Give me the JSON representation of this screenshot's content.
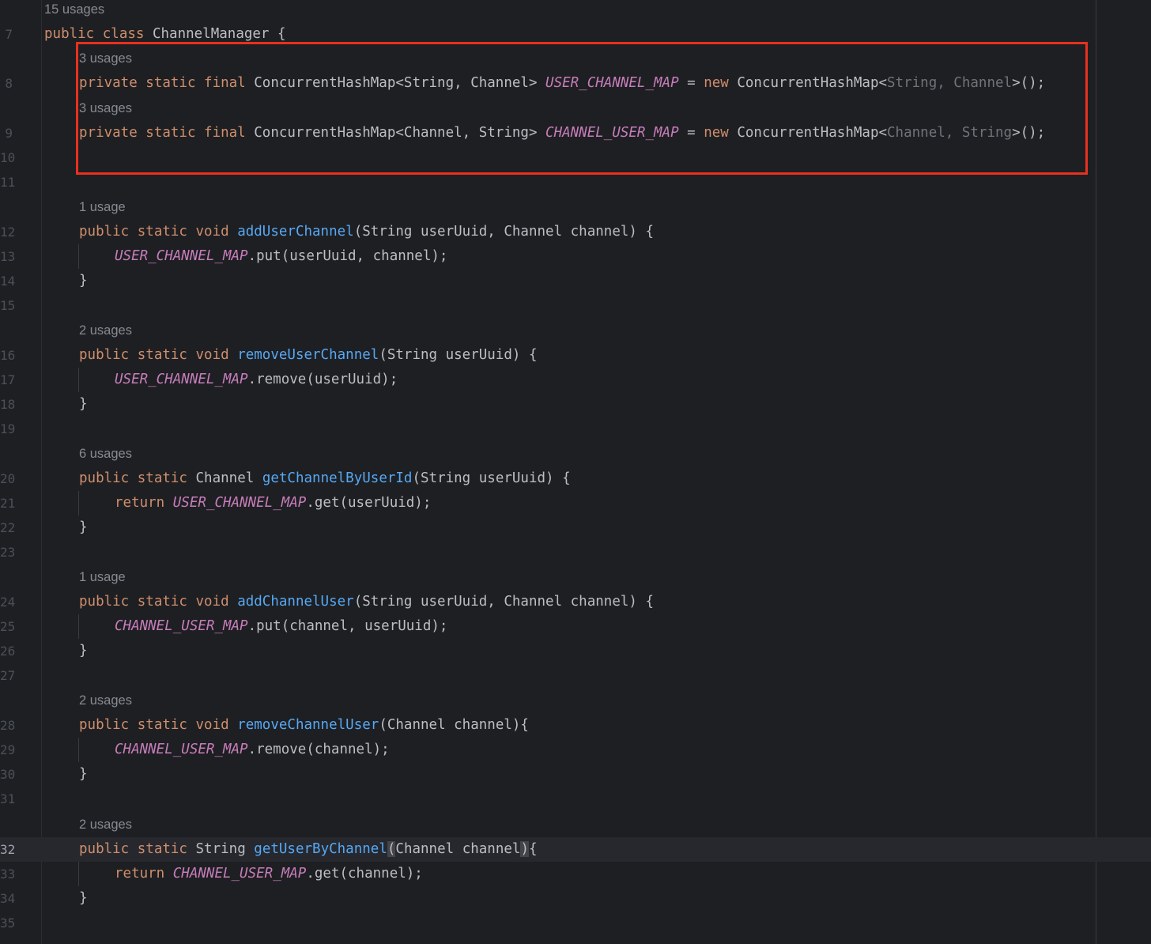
{
  "line_numbers": [
    "7",
    "8",
    "9",
    "10",
    "11",
    "12",
    "13",
    "14",
    "15",
    "16",
    "17",
    "18",
    "19",
    "20",
    "21",
    "22",
    "23",
    "24",
    "25",
    "26",
    "27",
    "28",
    "29",
    "30",
    "31",
    "32",
    "33",
    "34",
    "35"
  ],
  "hints": {
    "class": "15 usages",
    "field1": "3 usages",
    "field2": "3 usages",
    "m_addUserChannel": "1 usage",
    "m_removeUserChannel": "2 usages",
    "m_getChannelByUserId": "6 usages",
    "m_addChannelUser": "1 usage",
    "m_removeChannelUser": "2 usages",
    "m_getUserByChannel": "2 usages"
  },
  "code": {
    "class_decl": {
      "kw": "public class ",
      "name": "ChannelManager",
      "rest": " {"
    },
    "field1": {
      "mods": "private static final ",
      "type": "ConcurrentHashMap<String, Channel> ",
      "name": "USER_CHANNEL_MAP",
      "eq": " = ",
      "new": "new",
      "ctor": " ConcurrentHashMap<",
      "gen": "String, Channel",
      "end": ">();"
    },
    "field2": {
      "mods": "private static final ",
      "type": "ConcurrentHashMap<Channel, String> ",
      "name": "CHANNEL_USER_MAP",
      "eq": " = ",
      "new": "new",
      "ctor": " ConcurrentHashMap<",
      "gen": "Channel, String",
      "end": ">();"
    },
    "m1_sig": {
      "mods": "public static void ",
      "name": "addUserChannel",
      "params": "(String userUuid, Channel channel) {"
    },
    "m1_body": {
      "const": "USER_CHANNEL_MAP",
      "rest": ".put(userUuid, channel);"
    },
    "m2_sig": {
      "mods": "public static void ",
      "name": "removeUserChannel",
      "params": "(String userUuid) {"
    },
    "m2_body": {
      "const": "USER_CHANNEL_MAP",
      "rest": ".remove(userUuid);"
    },
    "m3_sig": {
      "mods": "public static ",
      "ret": "Channel ",
      "name": "getChannelByUserId",
      "params": "(String userUuid) {"
    },
    "m3_body": {
      "kw": "return ",
      "const": "USER_CHANNEL_MAP",
      "rest": ".get(userUuid);"
    },
    "m4_sig": {
      "mods": "public static void ",
      "name": "addChannelUser",
      "params": "(String userUuid, Channel channel) {"
    },
    "m4_body": {
      "const": "CHANNEL_USER_MAP",
      "rest": ".put(channel, userUuid);"
    },
    "m5_sig": {
      "mods": "public static void ",
      "name": "removeChannelUser",
      "params": "(Channel channel){"
    },
    "m5_body": {
      "const": "CHANNEL_USER_MAP",
      "rest": ".remove(channel);"
    },
    "m6_sig": {
      "mods": "public static ",
      "ret": "String ",
      "name": "getUserByChannel",
      "open": "(",
      "params": "Channel channel",
      "close": ")",
      "brace": "{"
    },
    "m6_body": {
      "kw": "return ",
      "const": "CHANNEL_USER_MAP",
      "rest": ".get(channel);"
    },
    "close_brace": "}"
  },
  "colors": {
    "background": "#1e1f22",
    "keyword": "#cf8e6d",
    "function": "#56a8f5",
    "constant": "#c77dbb",
    "highlight_box": "#e8311f"
  }
}
